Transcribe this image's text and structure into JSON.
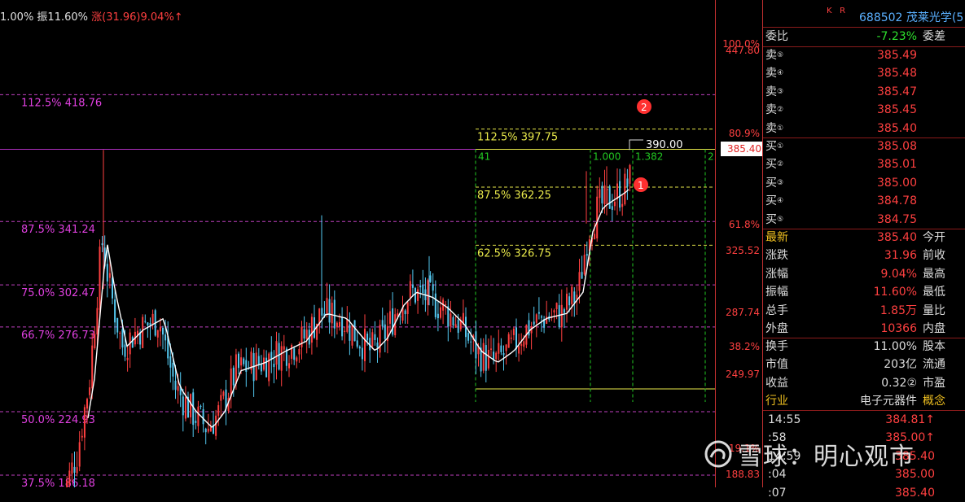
{
  "top_info": {
    "left_text": "1.00% 振11.60%",
    "rise_label": "涨(31.96)9.04%↑"
  },
  "chart_data": {
    "type": "candlestick",
    "ylim": [
      160,
      455
    ],
    "fib_left": [
      {
        "label": "112.5% 418.76",
        "price": 418.76
      },
      {
        "label": "87.5% 341.24",
        "price": 341.24
      },
      {
        "label": "75.0% 302.47",
        "price": 302.47
      },
      {
        "label": "66.7% 276.73",
        "price": 276.73
      },
      {
        "label": "50.0% 224.93",
        "price": 224.93
      },
      {
        "label": "37.5% 186.18",
        "price": 186.18
      }
    ],
    "fib_right": [
      {
        "label": "112.5% 397.75",
        "price": 397.75
      },
      {
        "label": "87.5% 362.25",
        "price": 362.25
      },
      {
        "label": "62.5% 326.75",
        "price": 326.75
      }
    ],
    "time_labels": [
      "41",
      "1.000",
      "1.382",
      "2."
    ],
    "high_label": "390.00",
    "markers": [
      "1",
      "2"
    ],
    "current_price_label": "385.40",
    "colors": {
      "up": "#ff4040",
      "down": "#54c8f0",
      "ma": "#ffffff",
      "fib": "#c040c0",
      "fib2": "#e8e84a",
      "grid": "#22c822"
    }
  },
  "axis": {
    "pct_labels": [
      {
        "text": "100.0%",
        "price": 447.8,
        "dy": -11
      },
      {
        "text": "80.9%",
        "price": 392.5,
        "dy": -12
      },
      {
        "text": "61.8%",
        "price": 337.0,
        "dy": -12
      },
      {
        "text": "38.2%",
        "price": 262.5,
        "dy": -12
      },
      {
        "text": "19.1%",
        "price": 200.0,
        "dy": -12
      }
    ],
    "price_labels": [
      {
        "text": "447.80",
        "price": 447.8
      },
      {
        "text": "325.52",
        "price": 325.52
      },
      {
        "text": "287.74",
        "price": 287.74
      },
      {
        "text": "249.97",
        "price": 249.97
      },
      {
        "text": "188.83",
        "price": 188.83
      }
    ]
  },
  "panel": {
    "header_kr": "K   R",
    "stock": "688502 茂莱光学(5",
    "weibi": {
      "label": "委比",
      "value": "-7.23%",
      "right": "委差"
    },
    "sells": [
      {
        "label": "卖",
        "key": "⑤",
        "price": "385.49"
      },
      {
        "label": "卖",
        "key": "④",
        "price": "385.48"
      },
      {
        "label": "卖",
        "key": "③",
        "price": "385.47"
      },
      {
        "label": "卖",
        "key": "②",
        "price": "385.45"
      },
      {
        "label": "卖",
        "key": "①",
        "price": "385.40"
      }
    ],
    "buys": [
      {
        "label": "买",
        "key": "①",
        "price": "385.08"
      },
      {
        "label": "买",
        "key": "②",
        "price": "385.01"
      },
      {
        "label": "买",
        "key": "③",
        "price": "385.00"
      },
      {
        "label": "买",
        "key": "④",
        "price": "384.78"
      },
      {
        "label": "买",
        "key": "⑤",
        "price": "384.75"
      }
    ],
    "stats": [
      {
        "label": "最新",
        "value": "385.40",
        "right": "今开"
      },
      {
        "label": "涨跌",
        "value": "31.96",
        "right": "前收"
      },
      {
        "label": "涨幅",
        "value": "9.04%",
        "right": "最高"
      },
      {
        "label": "振幅",
        "value": "11.60%",
        "right": "最低"
      },
      {
        "label": "总手",
        "value": "1.85万",
        "right": "量比"
      },
      {
        "label": "外盘",
        "value": "10366",
        "right": "内盘"
      }
    ],
    "stats2": [
      {
        "label": "换手",
        "value": "11.00%",
        "right": "股本"
      },
      {
        "label": "市值",
        "value": "203亿",
        "right": "流通"
      },
      {
        "label": "收益",
        "value": "0.32②",
        "right": "市盈"
      },
      {
        "label": "行业",
        "value": "电子元器件",
        "right": "概念"
      }
    ],
    "ticks": [
      {
        "time": "14:55",
        "price": "384.81↑"
      },
      {
        "time": ":58",
        "price": "385.00↑"
      },
      {
        "time": "14:59",
        "price": "385.40"
      },
      {
        "time": ":04",
        "price": "385.00"
      },
      {
        "time": ":07",
        "price": "385.40"
      }
    ]
  },
  "watermark": "雪球：明心观市"
}
